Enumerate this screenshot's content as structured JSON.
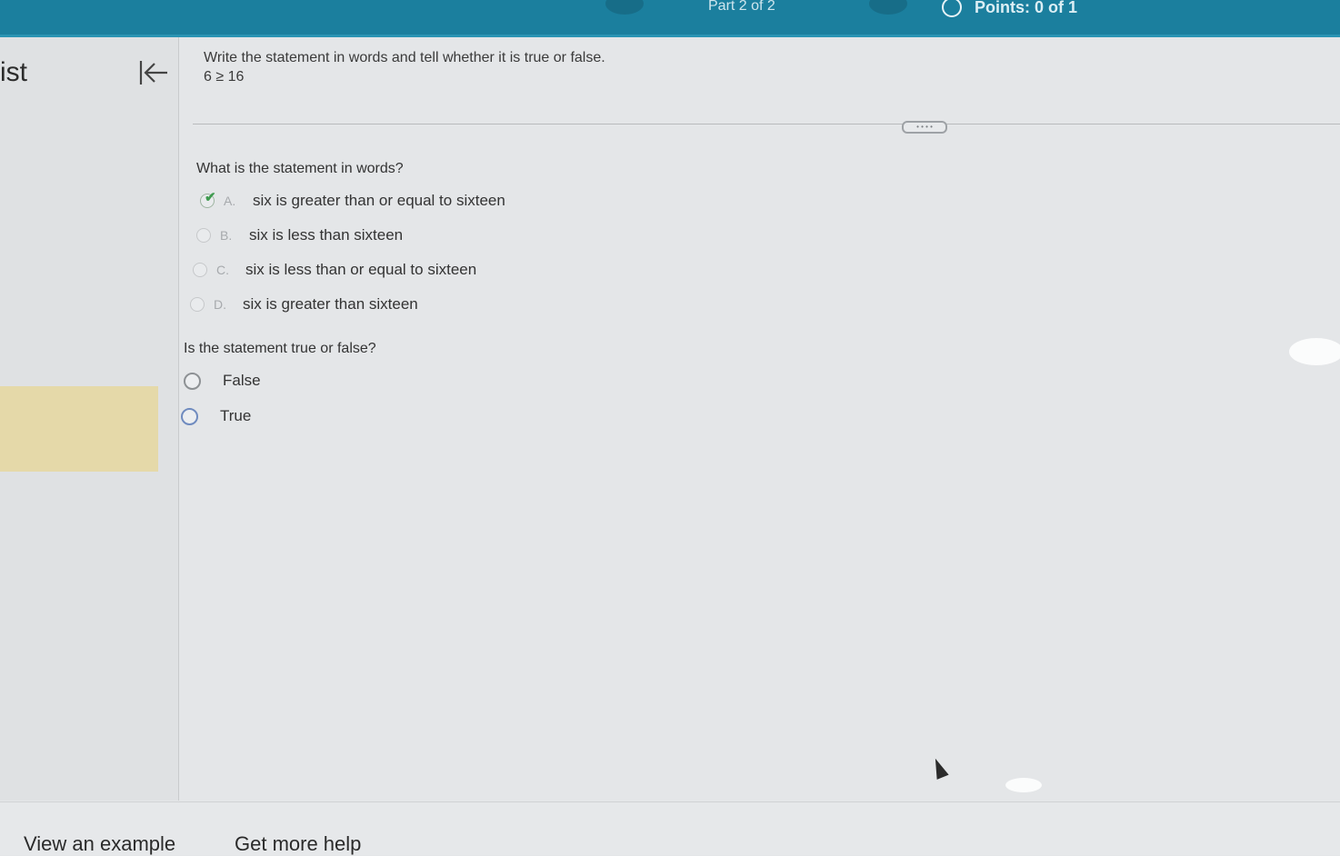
{
  "header": {
    "part_label": "Part 2 of 2",
    "points_label": "Points: 0 of 1"
  },
  "sidebar": {
    "title": "ist"
  },
  "question": {
    "instruction": "Write the statement in words and tell whether it is true or false.",
    "expression": "6 ≥ 16"
  },
  "part1": {
    "prompt": "What is the statement in words?",
    "choices": [
      {
        "letter": "A.",
        "text": "six is greater than or equal to sixteen",
        "selected": true
      },
      {
        "letter": "B.",
        "text": "six is less than sixteen",
        "selected": false
      },
      {
        "letter": "C.",
        "text": "six is less than or equal to sixteen",
        "selected": false
      },
      {
        "letter": "D.",
        "text": "six is greater than sixteen",
        "selected": false
      }
    ]
  },
  "part2": {
    "prompt": "Is the statement true or false?",
    "options": [
      "False",
      "True"
    ]
  },
  "footer": {
    "view_example": "View an example",
    "get_more_help": "Get more help"
  },
  "colors": {
    "header": "#1b7f9e",
    "highlight": "#e5d9a9",
    "check": "#3f9b4f"
  }
}
